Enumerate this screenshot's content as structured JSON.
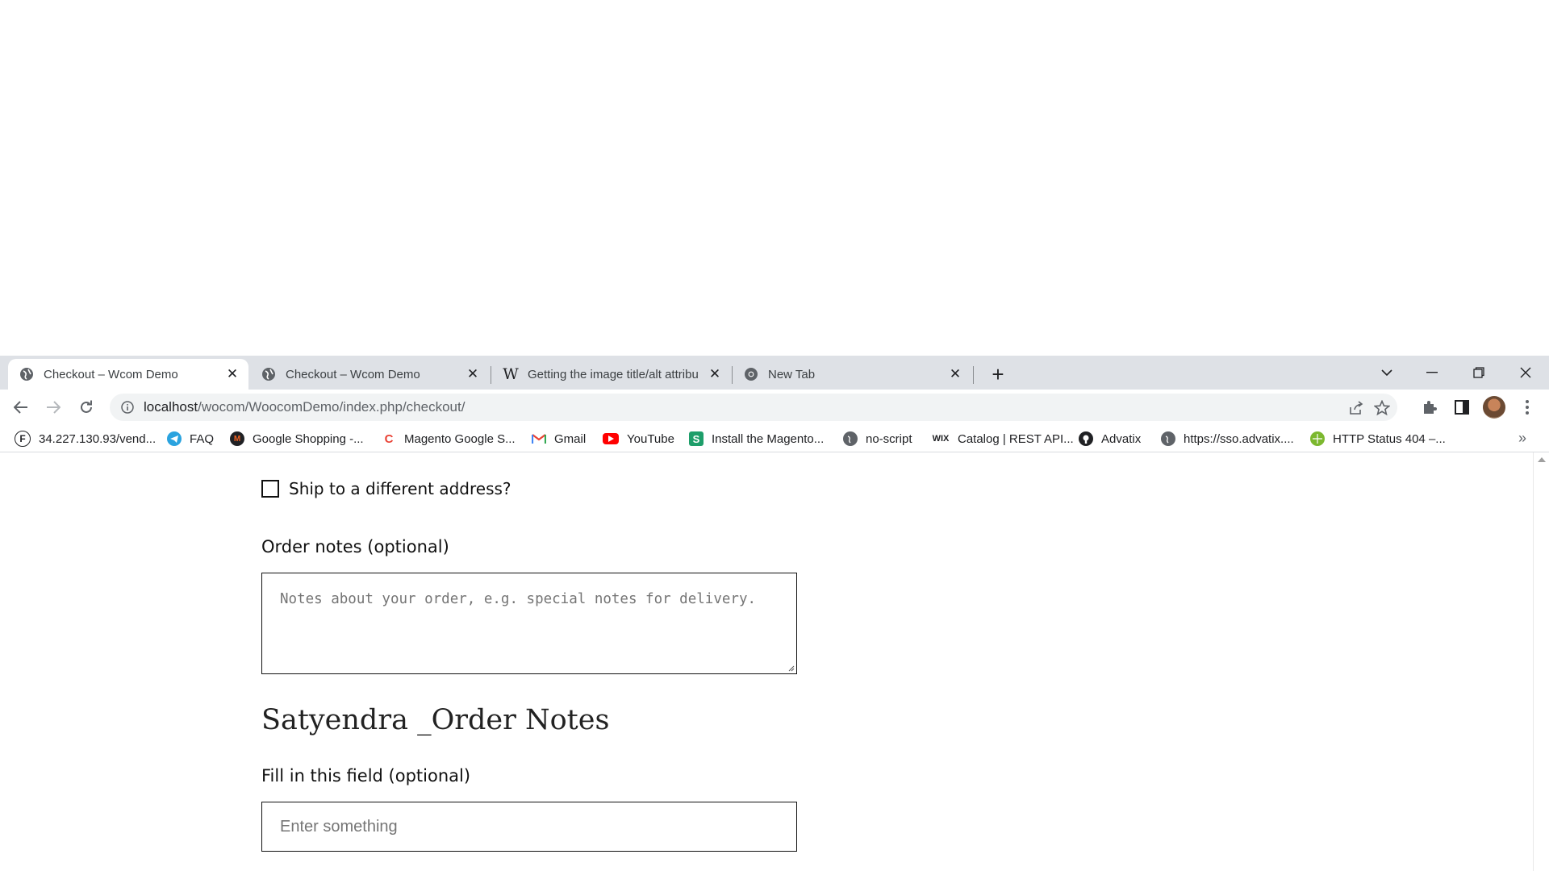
{
  "tabs": [
    {
      "title": "Checkout – Wcom Demo",
      "icon": "globe-icon",
      "active": true
    },
    {
      "title": "Checkout – Wcom Demo",
      "icon": "globe-icon",
      "active": false
    },
    {
      "title": "Getting the image title/alt attribu",
      "icon": "wikipedia-icon",
      "active": false
    },
    {
      "title": "New Tab",
      "icon": "chrome-icon",
      "active": false
    }
  ],
  "address_bar": {
    "host": "localhost",
    "path": "/wocom/WoocomDemo/index.php/checkout/"
  },
  "bookmarks": [
    {
      "label": "34.227.130.93/vend...",
      "icon": "f-icon"
    },
    {
      "label": "FAQ",
      "icon": "telegram-icon"
    },
    {
      "label": "Google Shopping -...",
      "icon": "magento-icon"
    },
    {
      "label": "Magento Google S...",
      "icon": "c-logo-icon"
    },
    {
      "label": "Gmail",
      "icon": "gmail-icon"
    },
    {
      "label": "YouTube",
      "icon": "youtube-icon"
    },
    {
      "label": "Install the Magento...",
      "icon": "s-icon"
    },
    {
      "label": "no-script",
      "icon": "globe-icon"
    },
    {
      "label": "Catalog | REST API...",
      "icon": "wix-icon"
    },
    {
      "label": "Advatix",
      "icon": "github-icon"
    },
    {
      "label": "https://sso.advatix....",
      "icon": "globe-icon"
    },
    {
      "label": "HTTP Status 404 –...",
      "icon": "green-globe-icon"
    }
  ],
  "page": {
    "ship_label": "Ship to a different address?",
    "order_notes_label": "Order notes (optional)",
    "order_notes_placeholder": "Notes about your order, e.g. special notes for delivery.",
    "section_title": "Satyendra _Order Notes",
    "custom_field_label": "Fill in this field (optional)",
    "custom_field_placeholder": "Enter something"
  },
  "colors": {
    "tabstrip": "#dee1e6",
    "youtube": "#ff0000",
    "telegram": "#2aa3df"
  }
}
